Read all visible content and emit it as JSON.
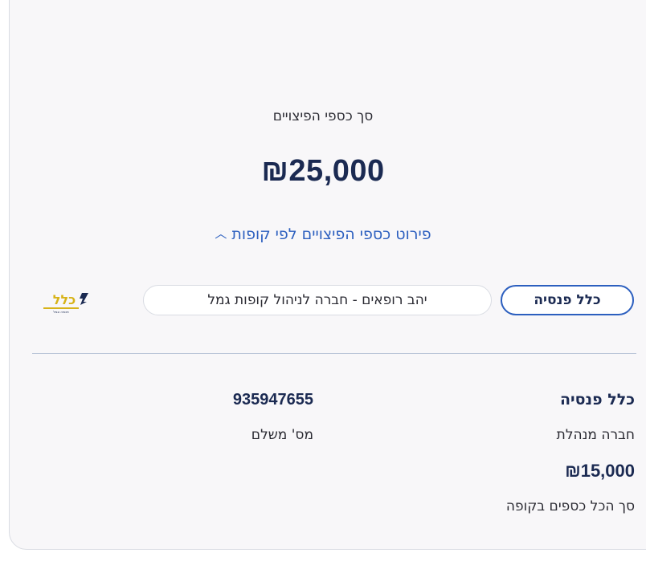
{
  "summary": {
    "total_label": "סך כספי הפיצויים",
    "total_amount": "₪25,000",
    "breakdown_toggle_label": "פירוט כספי הפיצויים לפי קופות",
    "breakdown_toggle_icon": "chevron-up-icon"
  },
  "funds_tabs": [
    {
      "label": "כלל פנסיה",
      "selected": true
    },
    {
      "label": "יהב רופאים - חברה לניהול קופות גמל",
      "selected": false
    }
  ],
  "logo": {
    "text": "כלל",
    "subtext": "פנסיה וגמל",
    "accent": "#d7b318",
    "brand": "#1b2a52"
  },
  "fund_details": {
    "fund_name": "כלל פנסיה",
    "fund_name_label": "חברה מנהלת",
    "fund_amount": "₪15,000",
    "fund_amount_label": "סך הכל כספים בקופה",
    "payer_number": "935947655",
    "payer_number_label": "מס' משלם"
  },
  "colors": {
    "primary_text": "#1b2a52",
    "link": "#2c5fbf",
    "card_bg": "#f8f7f9",
    "divider": "#b9c5d8"
  }
}
